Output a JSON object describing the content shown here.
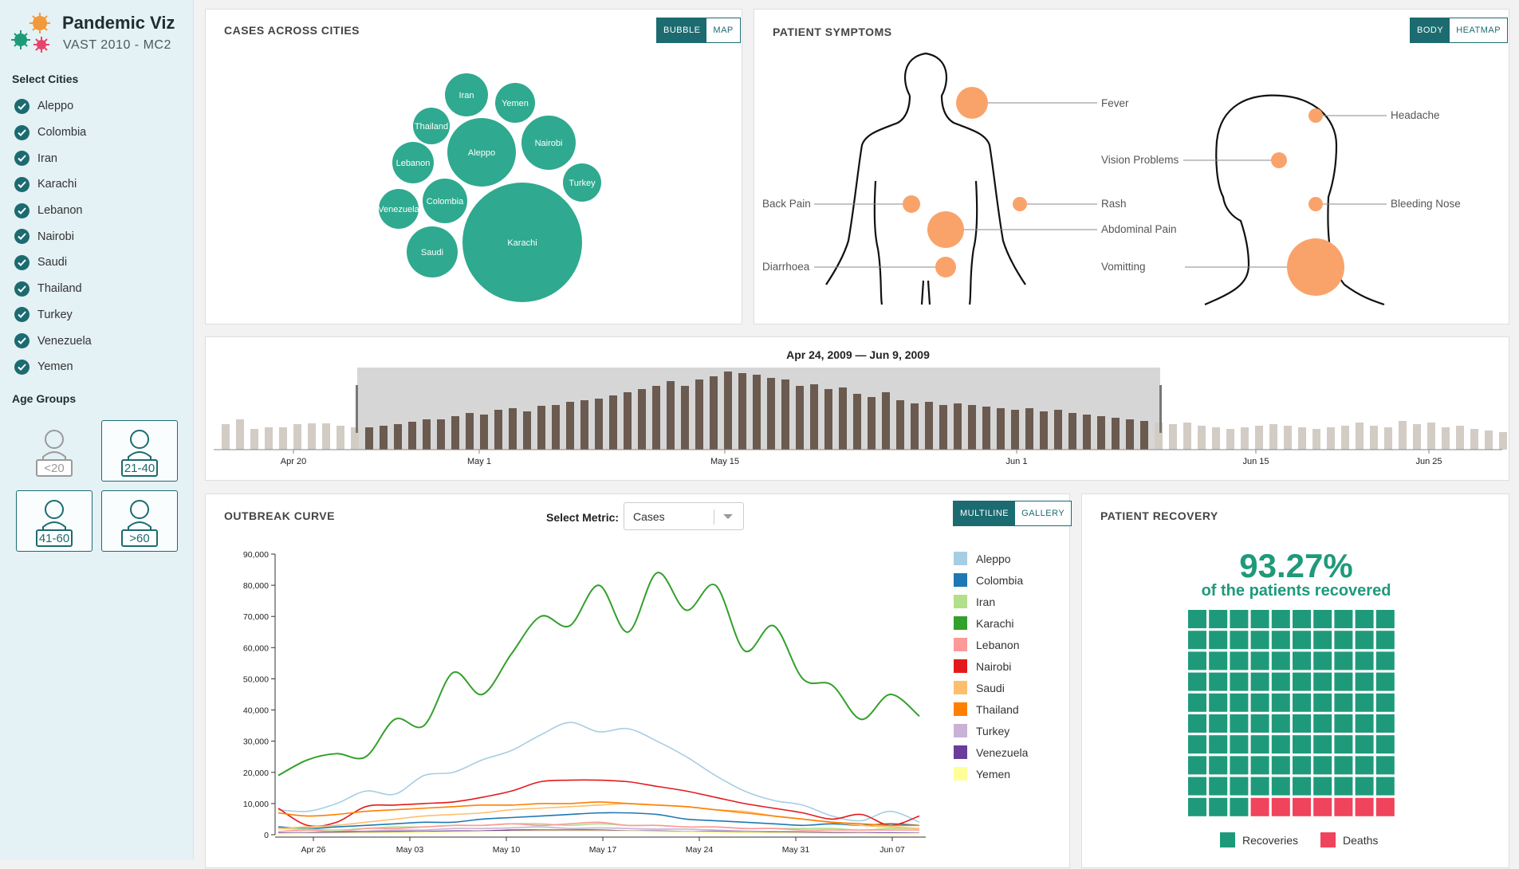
{
  "app": {
    "title": "Pandemic Viz",
    "subtitle": "VAST 2010 - MC2"
  },
  "sidebar": {
    "cities_label": "Select Cities",
    "cities": [
      "Aleppo",
      "Colombia",
      "Iran",
      "Karachi",
      "Lebanon",
      "Nairobi",
      "Saudi",
      "Thailand",
      "Turkey",
      "Venezuela",
      "Yemen"
    ],
    "age_label": "Age Groups",
    "age_groups": [
      {
        "label": "<20",
        "selected": false
      },
      {
        "label": "21-40",
        "selected": true
      },
      {
        "label": "41-60",
        "selected": true
      },
      {
        "label": ">60",
        "selected": true
      }
    ]
  },
  "cases_panel": {
    "title": "CASES ACROSS CITIES",
    "toggle": [
      "BUBBLE",
      "MAP"
    ],
    "bubbles": [
      {
        "city": "Karachi",
        "r": 75
      },
      {
        "city": "Aleppo",
        "r": 43
      },
      {
        "city": "Nairobi",
        "r": 34
      },
      {
        "city": "Iran",
        "r": 27
      },
      {
        "city": "Saudi",
        "r": 32
      },
      {
        "city": "Colombia",
        "r": 28
      },
      {
        "city": "Lebanon",
        "r": 26
      },
      {
        "city": "Yemen",
        "r": 25
      },
      {
        "city": "Thailand",
        "r": 23
      },
      {
        "city": "Turkey",
        "r": 24
      },
      {
        "city": "Venezuela",
        "r": 25
      }
    ]
  },
  "symptoms_panel": {
    "title": "PATIENT SYMPTOMS",
    "toggle": [
      "BODY",
      "HEATMAP"
    ],
    "body_symptoms": [
      "Fever",
      "Back Pain",
      "Rash",
      "Abdominal Pain",
      "Diarrhoea"
    ],
    "head_symptoms": [
      "Headache",
      "Vision Problems",
      "Bleeding Nose",
      "Vomitting"
    ]
  },
  "timeline": {
    "range_label": "Apr 24, 2009  —  Jun 9, 2009",
    "ticks": [
      "Apr 20",
      "May 1",
      "May 15",
      "Jun 1",
      "Jun 15",
      "Jun 25"
    ]
  },
  "outbreak": {
    "title": "OUTBREAK CURVE",
    "metric_label": "Select Metric:",
    "metric_value": "Cases",
    "toggle": [
      "MULTILINE",
      "GALLERY"
    ]
  },
  "chart_data": {
    "type": "line",
    "x": [
      "Apr 26",
      "Apr 28",
      "Apr 30",
      "May 02",
      "May 04",
      "May 06",
      "May 08",
      "May 10",
      "May 12",
      "May 14",
      "May 16",
      "May 18",
      "May 20",
      "May 22",
      "May 24",
      "May 26",
      "May 28",
      "May 30",
      "Jun 01",
      "Jun 03",
      "Jun 05",
      "Jun 07",
      "Jun 08"
    ],
    "x_ticks": [
      "Apr 26",
      "May 03",
      "May 10",
      "May 17",
      "May 24",
      "May 31",
      "Jun 07"
    ],
    "y_ticks": [
      "0",
      "10,000",
      "20,000",
      "30,000",
      "40,000",
      "50,000",
      "60,000",
      "70,000",
      "80,000",
      "90,000"
    ],
    "ylim": [
      0,
      90000
    ],
    "series": [
      {
        "name": "Aleppo",
        "color": "#a6cee3",
        "values": [
          8000,
          7500,
          10000,
          14000,
          13000,
          19000,
          20000,
          24000,
          27000,
          32000,
          36000,
          33000,
          34000,
          30000,
          25000,
          19000,
          14000,
          11000,
          9500,
          6000,
          4500,
          7500,
          4000
        ]
      },
      {
        "name": "Colombia",
        "color": "#1f78b4",
        "values": [
          2500,
          2000,
          2500,
          3000,
          3500,
          4000,
          4000,
          5000,
          5500,
          6000,
          6500,
          7000,
          7000,
          6500,
          5000,
          4500,
          4000,
          3500,
          3000,
          3500,
          3000,
          3500,
          3000
        ]
      },
      {
        "name": "Iran",
        "color": "#b2df8a",
        "values": [
          2000,
          1800,
          1500,
          2000,
          2500,
          2500,
          3000,
          3000,
          3500,
          3500,
          3000,
          3500,
          3000,
          3000,
          2500,
          2500,
          2000,
          2000,
          2000,
          2000,
          1500,
          2000,
          2000
        ]
      },
      {
        "name": "Karachi",
        "color": "#33a02c",
        "values": [
          19000,
          24000,
          26000,
          25000,
          37000,
          35000,
          52000,
          45000,
          58000,
          70000,
          67000,
          80000,
          65000,
          84000,
          72000,
          80000,
          59000,
          67000,
          50000,
          48000,
          37000,
          45000,
          38000
        ]
      },
      {
        "name": "Lebanon",
        "color": "#fb9a99",
        "values": [
          1000,
          1500,
          1000,
          2000,
          2000,
          2500,
          3000,
          3000,
          3500,
          3000,
          3500,
          4000,
          3000,
          3000,
          2500,
          2500,
          2000,
          2000,
          1500,
          1500,
          1500,
          1500,
          1500
        ]
      },
      {
        "name": "Nairobi",
        "color": "#e31a1c",
        "values": [
          8500,
          3000,
          4000,
          9000,
          9500,
          10000,
          10500,
          12000,
          14000,
          17000,
          17500,
          17500,
          17000,
          15500,
          14000,
          12000,
          10000,
          8500,
          7000,
          5000,
          6500,
          3000,
          6000
        ]
      },
      {
        "name": "Saudi",
        "color": "#fdbf6f",
        "values": [
          2000,
          2500,
          3000,
          4000,
          5000,
          6000,
          6500,
          7000,
          8000,
          8500,
          9000,
          9500,
          10000,
          9500,
          9000,
          8000,
          7500,
          6000,
          5000,
          4000,
          3000,
          2500,
          2000
        ]
      },
      {
        "name": "Thailand",
        "color": "#ff7f00",
        "values": [
          7000,
          6000,
          6500,
          7500,
          8000,
          8500,
          9000,
          9500,
          9500,
          10000,
          10000,
          10500,
          10000,
          9500,
          9000,
          8000,
          7000,
          6000,
          5000,
          4000,
          3500,
          3000,
          3000
        ]
      },
      {
        "name": "Turkey",
        "color": "#cab2d6",
        "values": [
          500,
          800,
          1000,
          1200,
          1500,
          1500,
          2000,
          2000,
          2200,
          2500,
          2000,
          2200,
          2000,
          1800,
          1800,
          1500,
          1200,
          1000,
          1000,
          800,
          800,
          600,
          500
        ]
      },
      {
        "name": "Venezuela",
        "color": "#6a3d9a",
        "values": [
          500,
          500,
          800,
          800,
          1000,
          1000,
          1200,
          1200,
          1500,
          1500,
          1500,
          1500,
          1200,
          1200,
          1000,
          1000,
          800,
          800,
          700,
          600,
          500,
          500,
          400
        ]
      },
      {
        "name": "Yemen",
        "color": "#ffff99",
        "values": [
          300,
          400,
          500,
          600,
          700,
          800,
          900,
          1000,
          1100,
          1200,
          1200,
          1200,
          1100,
          1000,
          900,
          800,
          700,
          600,
          500,
          400,
          400,
          300,
          300
        ]
      }
    ]
  },
  "recovery": {
    "title": "PATIENT RECOVERY",
    "percent_text": "93.27%",
    "subtitle": "of the patients recovered",
    "recovered_fraction": 0.9327,
    "legend": [
      "Recoveries",
      "Deaths"
    ],
    "colors": {
      "recovered": "#1e9a7a",
      "death": "#f0435c"
    }
  },
  "colors": {
    "accent": "#1b6b70",
    "bubble": "#2fa98f",
    "symptom": "#f9a36b"
  }
}
